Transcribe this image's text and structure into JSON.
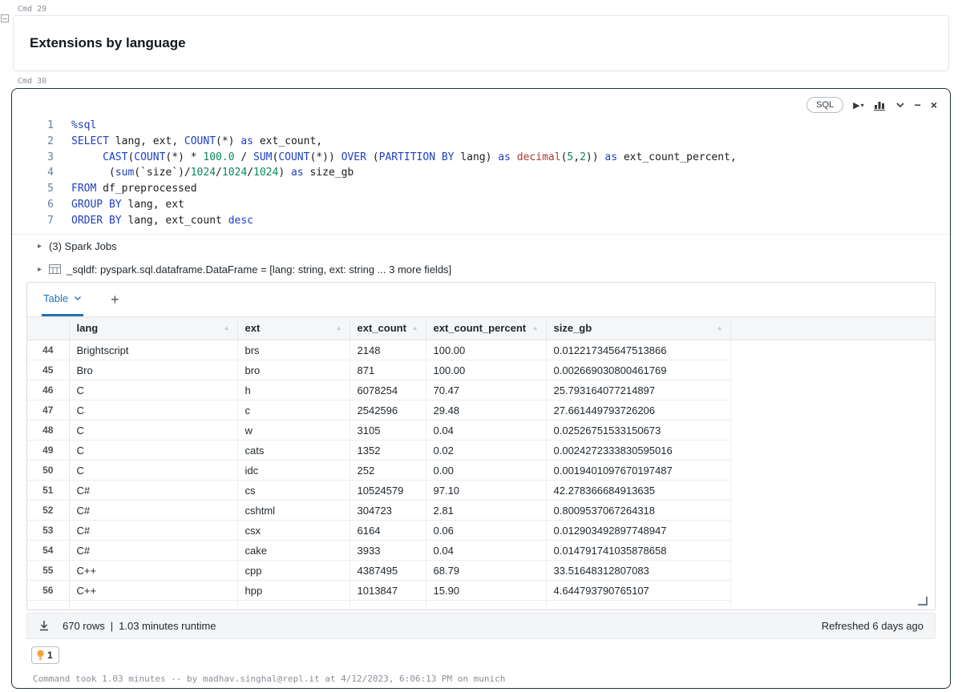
{
  "colors": {
    "accent_blue": "#2272b4",
    "syntax_keyword": "#1d3fc0",
    "syntax_number": "#09885a",
    "syntax_type": "#aa3731",
    "selected_cell_border": "#20313c",
    "lightbulb": "#f7a239"
  },
  "cmd29": {
    "label": "Cmd 29",
    "title": "Extensions by language"
  },
  "cmd30": {
    "label": "Cmd 30",
    "toolbar": {
      "lang_badge": "SQL"
    },
    "code": {
      "lines": [
        {
          "num": "1",
          "segments": [
            {
              "t": "%sql",
              "c": "k"
            }
          ]
        },
        {
          "num": "2",
          "segments": [
            {
              "t": "SELECT",
              "c": "k"
            },
            {
              "t": " lang, ext, ",
              "c": "p"
            },
            {
              "t": "COUNT",
              "c": "k"
            },
            {
              "t": "(*) ",
              "c": "p"
            },
            {
              "t": "as",
              "c": "k"
            },
            {
              "t": " ext_count,",
              "c": "p"
            }
          ]
        },
        {
          "num": "3",
          "segments": [
            {
              "t": "     ",
              "c": "p"
            },
            {
              "t": "CAST",
              "c": "k"
            },
            {
              "t": "(",
              "c": "p"
            },
            {
              "t": "COUNT",
              "c": "k"
            },
            {
              "t": "(*) * ",
              "c": "p"
            },
            {
              "t": "100.0",
              "c": "n"
            },
            {
              "t": " / ",
              "c": "p"
            },
            {
              "t": "SUM",
              "c": "k"
            },
            {
              "t": "(",
              "c": "p"
            },
            {
              "t": "COUNT",
              "c": "k"
            },
            {
              "t": "(*)) ",
              "c": "p"
            },
            {
              "t": "OVER",
              "c": "k"
            },
            {
              "t": " (",
              "c": "p"
            },
            {
              "t": "PARTITION BY",
              "c": "k"
            },
            {
              "t": " lang) ",
              "c": "p"
            },
            {
              "t": "as",
              "c": "k"
            },
            {
              "t": " ",
              "c": "p"
            },
            {
              "t": "decimal",
              "c": "d"
            },
            {
              "t": "(",
              "c": "p"
            },
            {
              "t": "5",
              "c": "n"
            },
            {
              "t": ",",
              "c": "p"
            },
            {
              "t": "2",
              "c": "n"
            },
            {
              "t": ")) ",
              "c": "p"
            },
            {
              "t": "as",
              "c": "k"
            },
            {
              "t": " ext_count_percent,",
              "c": "p"
            }
          ]
        },
        {
          "num": "4",
          "segments": [
            {
              "t": "      (",
              "c": "p"
            },
            {
              "t": "sum",
              "c": "k"
            },
            {
              "t": "(`size`)/",
              "c": "p"
            },
            {
              "t": "1024",
              "c": "n"
            },
            {
              "t": "/",
              "c": "p"
            },
            {
              "t": "1024",
              "c": "n"
            },
            {
              "t": "/",
              "c": "p"
            },
            {
              "t": "1024",
              "c": "n"
            },
            {
              "t": ") ",
              "c": "p"
            },
            {
              "t": "as",
              "c": "k"
            },
            {
              "t": " size_gb",
              "c": "p"
            }
          ]
        },
        {
          "num": "5",
          "segments": [
            {
              "t": "FROM",
              "c": "k"
            },
            {
              "t": " df_preprocessed",
              "c": "p"
            }
          ]
        },
        {
          "num": "6",
          "segments": [
            {
              "t": "GROUP BY",
              "c": "k"
            },
            {
              "t": " lang, ext",
              "c": "p"
            }
          ]
        },
        {
          "num": "7",
          "segments": [
            {
              "t": "ORDER BY",
              "c": "k"
            },
            {
              "t": " lang, ext_count ",
              "c": "p"
            },
            {
              "t": "desc",
              "c": "k"
            }
          ]
        }
      ]
    },
    "spark_jobs_label": "(3) Spark Jobs",
    "sqldf_label": "_sqldf:  pyspark.sql.dataframe.DataFrame = [lang: string, ext: string ... 3 more fields]",
    "result_tabs": {
      "active_tab": "Table",
      "add_button": "+"
    },
    "table": {
      "columns": [
        "lang",
        "ext",
        "ext_count",
        "ext_count_percent",
        "size_gb"
      ],
      "rows": [
        {
          "n": "44",
          "cells": [
            "Brightscript",
            "brs",
            "2148",
            "100.00",
            "0.012217345647513866"
          ]
        },
        {
          "n": "45",
          "cells": [
            "Bro",
            "bro",
            "871",
            "100.00",
            "0.002669030800461769"
          ]
        },
        {
          "n": "46",
          "cells": [
            "C",
            "h",
            "6078254",
            "70.47",
            "25.793164077214897"
          ]
        },
        {
          "n": "47",
          "cells": [
            "C",
            "c",
            "2542596",
            "29.48",
            "27.661449793726206"
          ]
        },
        {
          "n": "48",
          "cells": [
            "C",
            "w",
            "3105",
            "0.04",
            "0.02526751533150673"
          ]
        },
        {
          "n": "49",
          "cells": [
            "C",
            "cats",
            "1352",
            "0.02",
            "0.0024272333830595016"
          ]
        },
        {
          "n": "50",
          "cells": [
            "C",
            "idc",
            "252",
            "0.00",
            "0.0019401097670197487"
          ]
        },
        {
          "n": "51",
          "cells": [
            "C#",
            "cs",
            "10524579",
            "97.10",
            "42.278366684913635"
          ]
        },
        {
          "n": "52",
          "cells": [
            "C#",
            "cshtml",
            "304723",
            "2.81",
            "0.8009537067264318"
          ]
        },
        {
          "n": "53",
          "cells": [
            "C#",
            "csx",
            "6164",
            "0.06",
            "0.012903492897748947"
          ]
        },
        {
          "n": "54",
          "cells": [
            "C#",
            "cake",
            "3933",
            "0.04",
            "0.014791741035878658"
          ]
        },
        {
          "n": "55",
          "cells": [
            "C++",
            "cpp",
            "4387495",
            "68.79",
            "33.51648312807083"
          ]
        },
        {
          "n": "56",
          "cells": [
            "C++",
            "hpp",
            "1013847",
            "15.90",
            "4.644793790765107"
          ]
        }
      ],
      "clipped_row": {
        "n": "",
        "cells": [
          "",
          "",
          "",
          "",
          ""
        ]
      }
    },
    "footer": {
      "rows_count": "670 rows",
      "separator": "|",
      "runtime": "1.03 minutes runtime",
      "refreshed": "Refreshed 6 days ago"
    },
    "comments": {
      "count": "1"
    },
    "status_line": "Command took 1.03 minutes -- by madhav.singhal@repl.it at 4/12/2023, 6:06:13 PM on munich"
  }
}
